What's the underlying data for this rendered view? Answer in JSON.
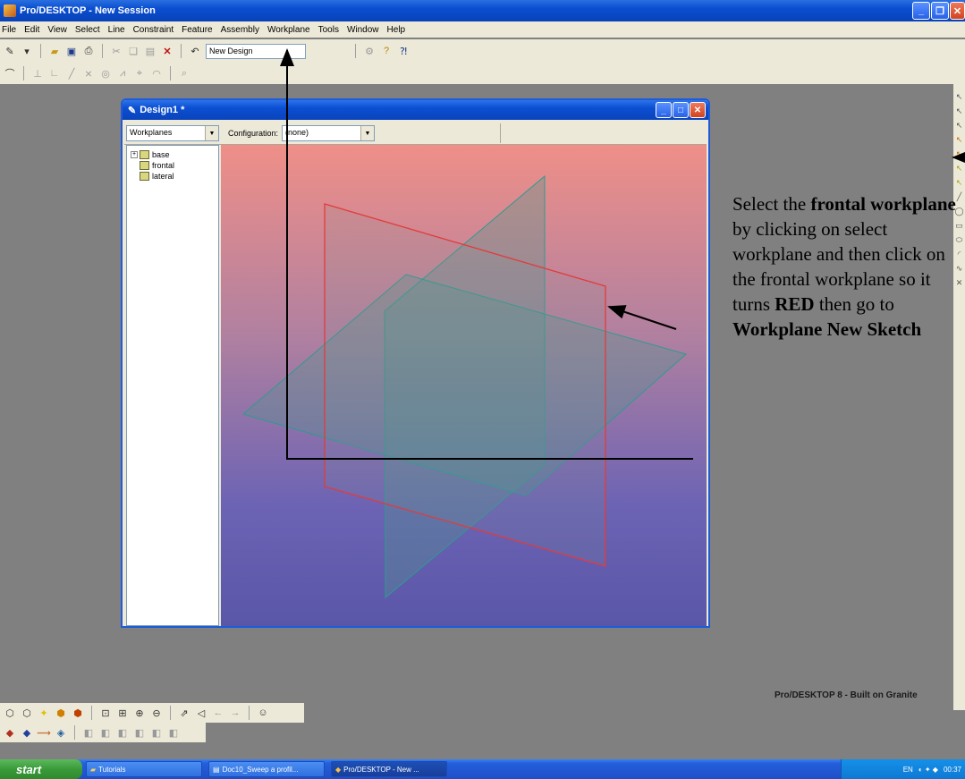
{
  "app": {
    "title": "Pro/DESKTOP - New Session"
  },
  "menu": [
    "File",
    "Edit",
    "View",
    "Select",
    "Line",
    "Constraint",
    "Feature",
    "Assembly",
    "Workplane",
    "Tools",
    "Window",
    "Help"
  ],
  "toolbar": {
    "design_name": "New Design"
  },
  "design_window": {
    "title": "Design1 *",
    "selector_value": "Workplanes",
    "config_label": "Configuration:",
    "config_value": "(none)",
    "tree_items": [
      "base",
      "frontal",
      "lateral"
    ]
  },
  "annotation": {
    "p1": "Select the ",
    "b1": "frontal workplane",
    "p2": " by clicking on select workplane and then click on the frontal workplane so it turns ",
    "b2": "RED",
    "p3": " then go to ",
    "b3": "Workplane New Sketch"
  },
  "brand": "Pro/DESKTOP 8 - Built on Granite",
  "taskbar": {
    "start_label": "start",
    "tasks": [
      "Tutorials",
      "Doc10_Sweep a profil...",
      "Pro/DESKTOP - New ..."
    ],
    "lang": "EN",
    "clock": "00:37"
  },
  "colors": {
    "selected_plane": "#e23b3b",
    "plane_edge": "#2f9a90",
    "titlebar": "#0a4ed0"
  }
}
